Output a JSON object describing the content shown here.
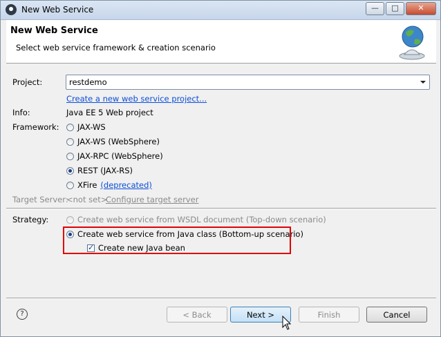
{
  "window": {
    "title": "New Web Service",
    "controls": [
      "minimize",
      "maximize",
      "close"
    ]
  },
  "header": {
    "title": "New Web Service",
    "subtitle": "Select web service framework & creation scenario",
    "icon": "globe-bell-icon"
  },
  "form": {
    "project_label": "Project:",
    "project_value": "restdemo",
    "create_project_link": "Create a new web service project...",
    "info_label": "Info:",
    "info_value": "Java EE 5 Web project",
    "framework_label": "Framework:",
    "frameworks": [
      {
        "label": "JAX-WS",
        "selected": false
      },
      {
        "label": "JAX-WS (WebSphere)",
        "selected": false
      },
      {
        "label": "JAX-RPC (WebSphere)",
        "selected": false
      },
      {
        "label": "REST (JAX-RS)",
        "selected": true
      },
      {
        "label": "XFire",
        "selected": false
      }
    ],
    "xfire_note": "(deprecated)",
    "target_server_label": "Target Server:",
    "target_server_value": "<not set>",
    "configure_link": "Configure target server",
    "strategy_label": "Strategy:",
    "strategy_wsdl": "Create web service from WSDL document (Top-down scenario)",
    "strategy_java": "Create web service from Java class (Bottom-up scenario)",
    "create_bean_label": "Create new Java bean",
    "create_bean_checked": true
  },
  "buttons": {
    "help": "?",
    "back": "< Back",
    "next": "Next >",
    "finish": "Finish",
    "cancel": "Cancel"
  },
  "colors": {
    "link": "#0b4ed8",
    "highlight": "#e00000",
    "selection": "#1a3f8e"
  }
}
